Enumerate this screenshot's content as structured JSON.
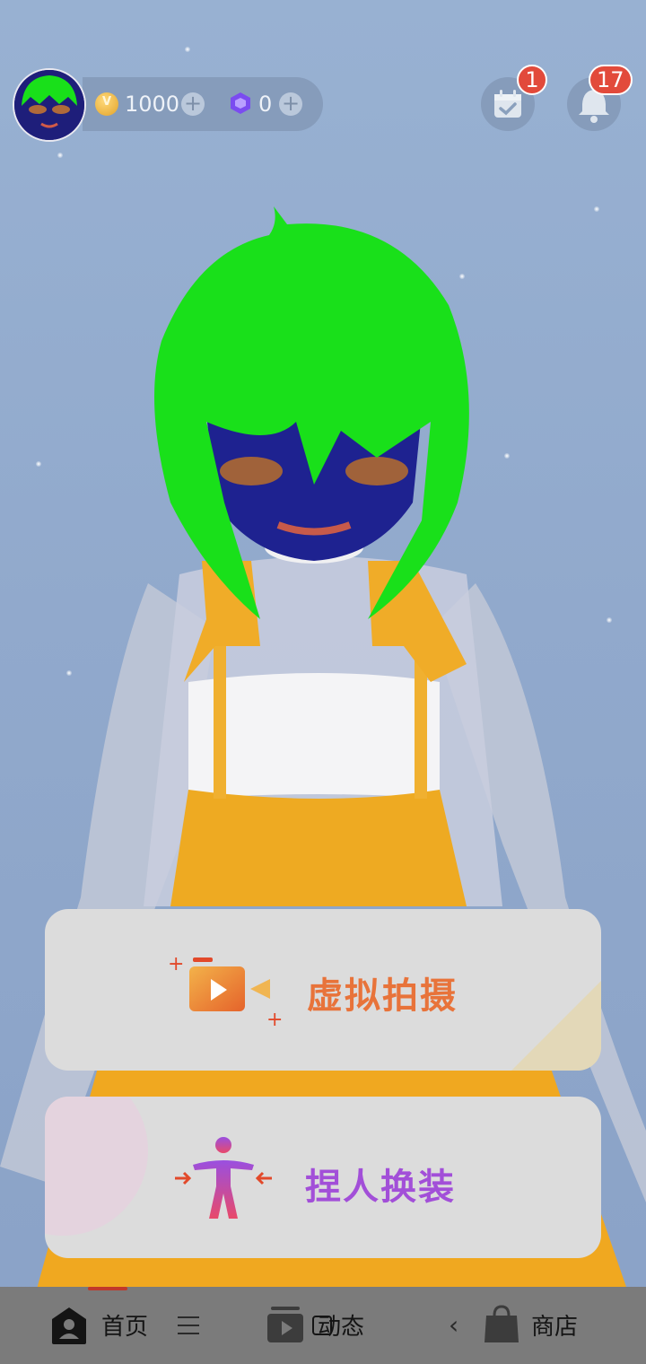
{
  "header": {
    "coins": "1000",
    "gems": "0",
    "calendar_badge": "1",
    "notification_badge": "17"
  },
  "actions": {
    "virtual_shoot": "虚拟拍摄",
    "pinch_dress": "捏人换装"
  },
  "nav": {
    "home": "首页",
    "feed": "动态",
    "shop": "商店",
    "active": "home"
  },
  "colors": {
    "badge": "#e24a3b",
    "active_indicator": "#c0392b",
    "shoot_gradient": [
      "#f0a040",
      "#e0602a"
    ],
    "pinch_gradient": [
      "#8a4fe0",
      "#e0406a"
    ]
  }
}
